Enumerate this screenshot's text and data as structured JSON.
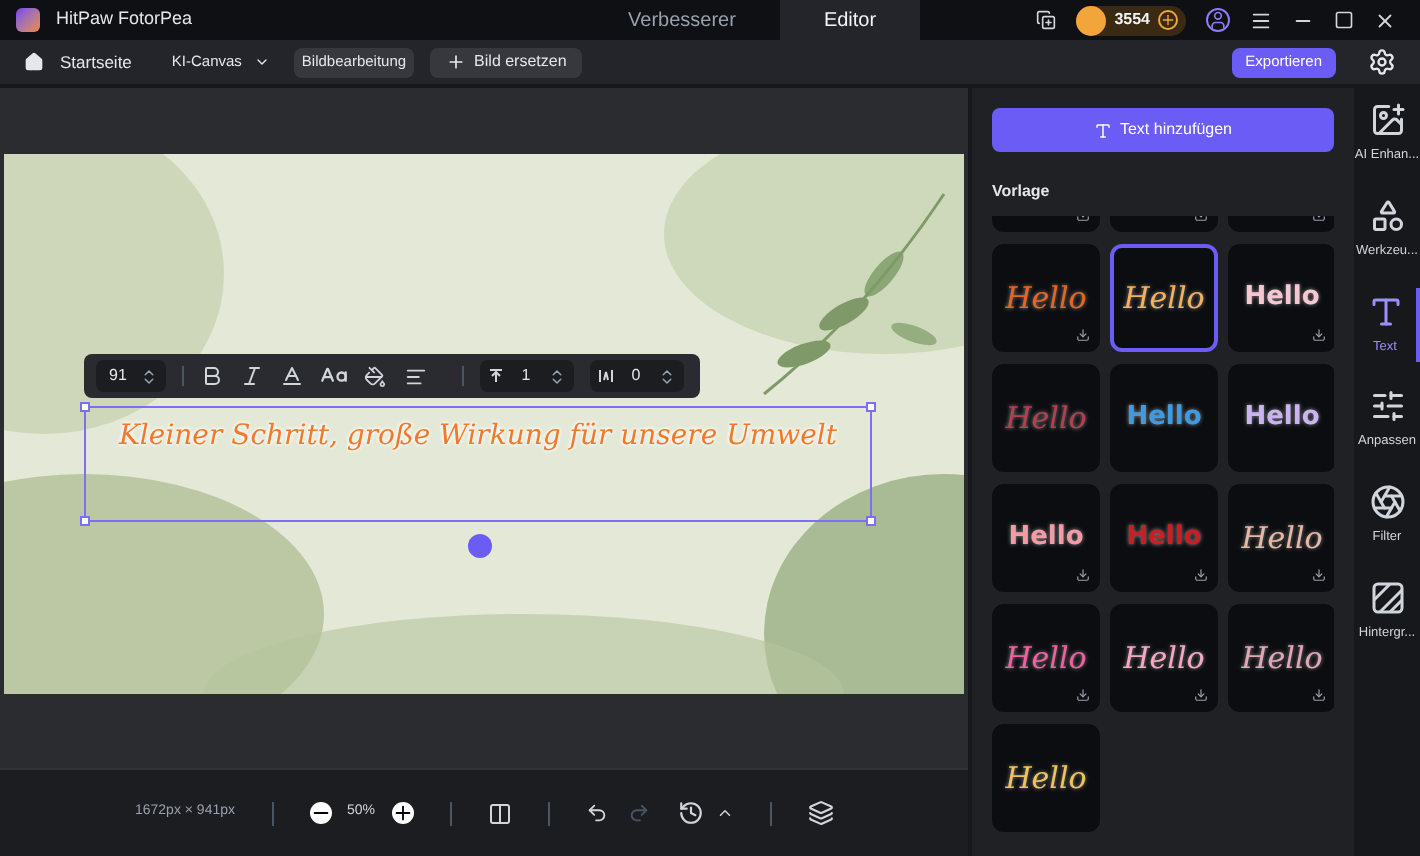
{
  "app": {
    "name": "HitPaw FotorPea"
  },
  "mode_tabs": [
    {
      "label": "Verbesserer",
      "selected": false
    },
    {
      "label": "Editor",
      "selected": true
    }
  ],
  "credits": "3554",
  "toolbar": {
    "home": "Startseite",
    "menu": "KI-Canvas",
    "chip": "Bildbearbeitung",
    "replace": "Bild ersetzen",
    "export": "Exportieren"
  },
  "text_toolbar": {
    "font_size": "91",
    "line_spacing": "1",
    "letter_spacing": "0"
  },
  "canvas_text": "Kleiner Schritt, große Wirkung für unsere Umwelt",
  "status_bar": {
    "dimensions": "1672px × 941px",
    "zoom": "50%"
  },
  "panel": {
    "add_button": "Text hinzufügen",
    "section": "Vorlage",
    "templates": [
      {
        "kind": "blank",
        "downloadable": true,
        "selected": false
      },
      {
        "kind": "blank",
        "downloadable": true,
        "selected": false
      },
      {
        "kind": "blank",
        "downloadable": true,
        "selected": false
      },
      {
        "kind": "script",
        "label": "Hello",
        "color": "#e8651f",
        "downloadable": true,
        "selected": false
      },
      {
        "kind": "script",
        "label": "Hello",
        "color": "#f5b15c",
        "downloadable": false,
        "selected": true
      },
      {
        "kind": "bold",
        "label": "Hello",
        "color": "#f7c6d3",
        "downloadable": true,
        "selected": false
      },
      {
        "kind": "script",
        "label": "Hello",
        "color": "#b3404f",
        "downloadable": false,
        "selected": false
      },
      {
        "kind": "bold",
        "label": "Hello",
        "color": "#3d9be3",
        "downloadable": false,
        "selected": false
      },
      {
        "kind": "bold",
        "label": "Hello",
        "color": "#c9b3f0",
        "downloadable": false,
        "selected": false
      },
      {
        "kind": "bold",
        "label": "Hello",
        "color": "#f29aa6",
        "downloadable": true,
        "selected": false
      },
      {
        "kind": "bold",
        "label": "Hello",
        "color": "#c81e24",
        "downloadable": true,
        "selected": false
      },
      {
        "kind": "script",
        "label": "Hello",
        "color": "#e8b7a5",
        "downloadable": true,
        "selected": false
      },
      {
        "kind": "script",
        "label": "Hello",
        "color": "#f25fa0",
        "downloadable": true,
        "selected": false
      },
      {
        "kind": "script",
        "label": "Hello",
        "color": "#f7a8c0",
        "downloadable": true,
        "selected": false
      },
      {
        "kind": "script",
        "label": "Hello",
        "color": "#e3a6b6",
        "downloadable": true,
        "selected": false
      },
      {
        "kind": "script",
        "label": "Hello",
        "color": "#f0c35a",
        "downloadable": false,
        "selected": false
      }
    ]
  },
  "rail": [
    {
      "kind": "enhance",
      "label": "AI Enhan...",
      "selected": false
    },
    {
      "kind": "tools",
      "label": "Werkzeu...",
      "selected": false
    },
    {
      "kind": "text",
      "label": "Text",
      "selected": true
    },
    {
      "kind": "adjust",
      "label": "Anpassen",
      "selected": false
    },
    {
      "kind": "filter",
      "label": "Filter",
      "selected": false
    },
    {
      "kind": "background",
      "label": "Hintergr...",
      "selected": false
    }
  ]
}
